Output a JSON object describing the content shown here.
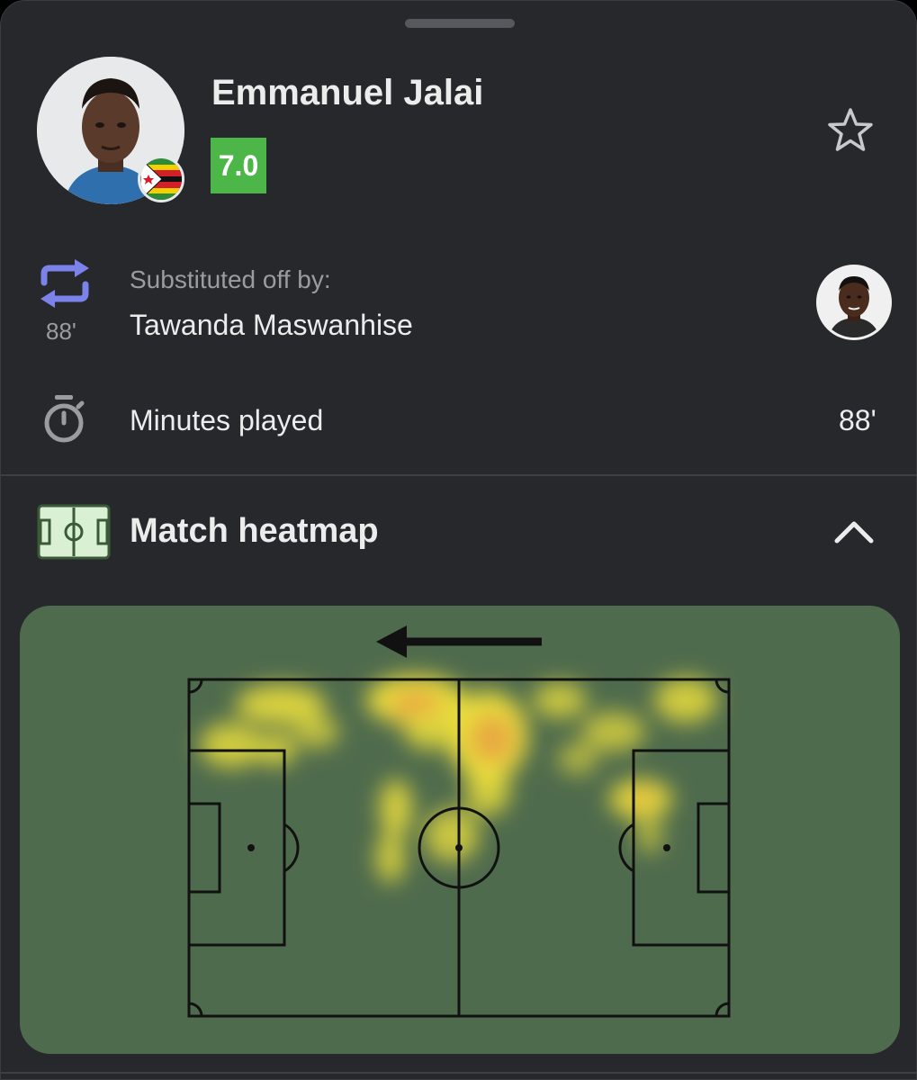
{
  "player": {
    "name": "Emmanuel Jalai",
    "rating": "7.0",
    "rating_color": "#4cb748",
    "nationality_flag": "zimbabwe-flag"
  },
  "substitution": {
    "icon": "substitution-icon",
    "minute": "88'",
    "label": "Substituted off by:",
    "player_name": "Tawanda Maswanhise",
    "accent_color": "#7b83eb"
  },
  "minutes_played": {
    "icon": "stopwatch-icon",
    "label": "Minutes played",
    "value": "88'"
  },
  "heatmap": {
    "icon": "pitch-icon",
    "title": "Match heatmap",
    "toggle_icon": "chevron-up-icon",
    "attack_direction": "left",
    "pitch_color": "#4f6b4d"
  },
  "favorite": {
    "icon": "star-outline-icon"
  }
}
